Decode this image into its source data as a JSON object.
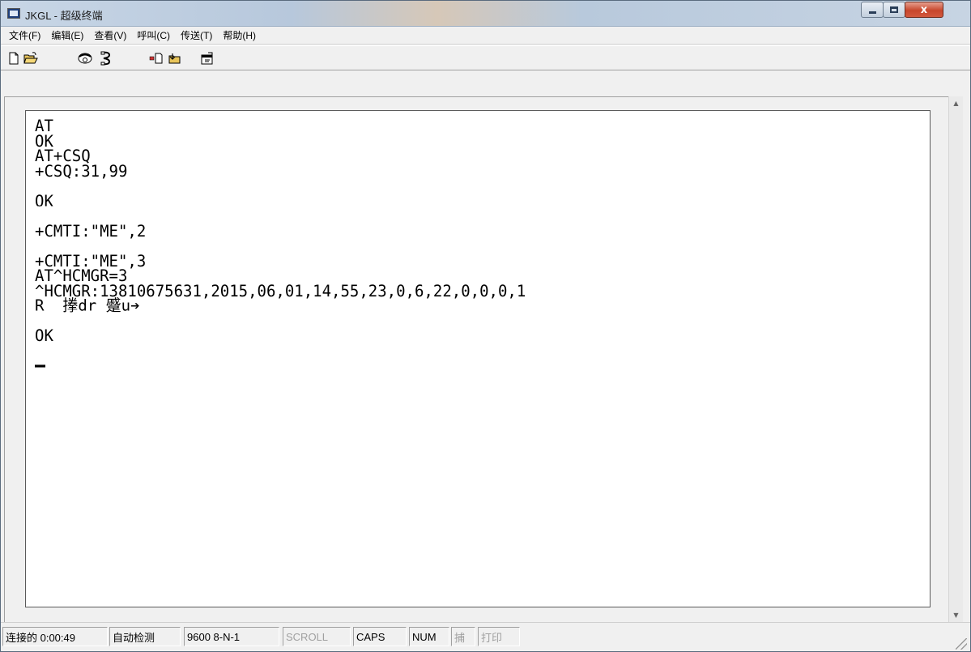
{
  "window": {
    "title": "JKGL - 超级终端",
    "close_glyph": "x"
  },
  "menu": [
    {
      "label": "文件(F)"
    },
    {
      "label": "编辑(E)"
    },
    {
      "label": "查看(V)"
    },
    {
      "label": "呼叫(C)"
    },
    {
      "label": "传送(T)"
    },
    {
      "label": "帮助(H)"
    }
  ],
  "toolbar": {
    "icons": [
      "new-icon",
      "open-icon",
      "call-icon",
      "disconnect-icon",
      "send-icon",
      "receive-icon",
      "properties-icon"
    ]
  },
  "terminal": {
    "lines": [
      "AT",
      "OK",
      "AT+CSQ",
      "+CSQ:31,99",
      "",
      "OK",
      "",
      "+CMTI:\"ME\",2",
      "",
      "+CMTI:\"ME\",3",
      "AT^HCMGR=3",
      "^HCMGR:13810675631,2015,06,01,14,55,23,0,6,22,0,0,0,1",
      "R  搼dr 蹙u➔",
      "",
      "OK",
      ""
    ]
  },
  "statusbar": {
    "connected": "连接的 0:00:49",
    "detect": "自动检测",
    "settings": "9600 8-N-1",
    "scroll": "SCROLL",
    "caps": "CAPS",
    "num": "NUM",
    "capture": "捕",
    "print": "打印"
  },
  "colors": {
    "terminal_bg": "#ffffff",
    "close_button": "#c7472c"
  }
}
